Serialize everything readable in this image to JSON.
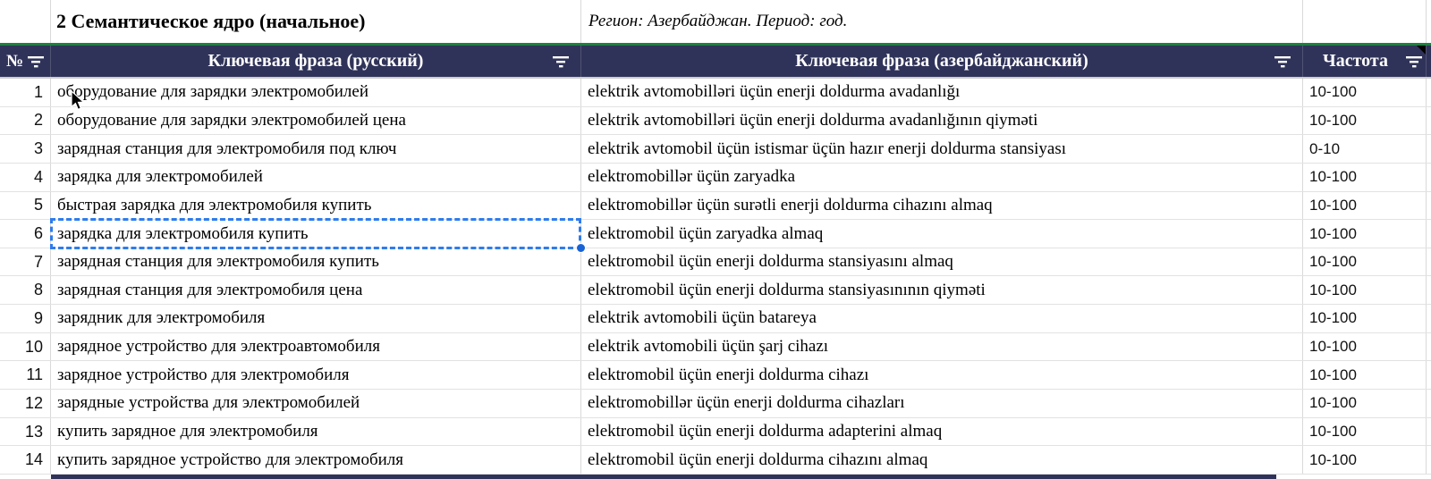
{
  "title_row": {
    "title": "2 Семантическое ядро (начальное)",
    "region_note": "Регион: Азербайджан. Период: год."
  },
  "table": {
    "headers": {
      "num": "№",
      "ru": "Ключевая фраза (русский)",
      "az": "Ключевая фраза (азербайджанский)",
      "freq": "Частота"
    },
    "rows": [
      {
        "num": "1",
        "ru": "оборудование для зарядки электромобилей",
        "az": "elektrik avtomobilləri üçün enerji doldurma avadanlığı",
        "freq": "10-100"
      },
      {
        "num": "2",
        "ru": "оборудование для зарядки электромобилей цена",
        "az": "elektrik avtomobilləri üçün enerji doldurma avadanlığının qiyməti",
        "freq": "10-100"
      },
      {
        "num": "3",
        "ru": "зарядная станция для электромобиля под ключ",
        "az": "elektrik avtomobil üçün istismar üçün hazır enerji doldurma stansiyası",
        "freq": "0-10"
      },
      {
        "num": "4",
        "ru": "зарядка для электромобилей",
        "az": "elektromobillər üçün zaryadka",
        "freq": "10-100"
      },
      {
        "num": "5",
        "ru": "быстрая зарядка для электромобиля купить",
        "az": "elektromobillər üçün surətli enerji doldurma cihazını almaq",
        "freq": "10-100"
      },
      {
        "num": "6",
        "ru": "зарядка для электромобиля купить",
        "az": "elektromobil üçün zaryadka almaq",
        "freq": "10-100",
        "selected": true
      },
      {
        "num": "7",
        "ru": "зарядная станция для электромобиля купить",
        "az": "elektromobil üçün enerji doldurma stansiyasını almaq",
        "freq": "10-100"
      },
      {
        "num": "8",
        "ru": "зарядная станция для электромобиля цена",
        "az": "elektromobil üçün enerji doldurma stansiyasınının qiyməti",
        "freq": "10-100"
      },
      {
        "num": "9",
        "ru": "зарядник для электромобиля",
        "az": "elektrik avtomobili üçün batareya",
        "freq": "10-100"
      },
      {
        "num": "10",
        "ru": "зарядное устройство для электроавтомобиля",
        "az": "elektrik avtomobili üçün şarj cihazı",
        "freq": "10-100"
      },
      {
        "num": "11",
        "ru": "зарядное устройство для электромобиля",
        "az": "elektromobil üçün enerji doldurma cihazı",
        "freq": "10-100"
      },
      {
        "num": "12",
        "ru": "зарядные устройства для электромобилей",
        "az": "elektromobillər üçün enerji doldurma cihazları",
        "freq": "10-100"
      },
      {
        "num": "13",
        "ru": "купить зарядное для электромобиля",
        "az": "elektromobil üçün enerji doldurma adapterini almaq",
        "freq": "10-100"
      },
      {
        "num": "14",
        "ru": "купить зарядное устройство для электромобиля",
        "az": "elektromobil üçün enerji doldurma cihazını almaq",
        "freq": "10-100"
      }
    ]
  },
  "icons": {
    "filter": "filter-icon (three tapering bars)",
    "note": "note-marker (black corner triangle)",
    "cursor": "mouse-cursor (arrow pointer)",
    "handle": "fill-handle (blue dot)"
  },
  "colors": {
    "header_bg": "#303359",
    "range_border_green": "#1e8040",
    "selection_blue": "#2e7ceb",
    "fill_handle_blue": "#1763d6",
    "gridline": "#d9d9d9"
  }
}
